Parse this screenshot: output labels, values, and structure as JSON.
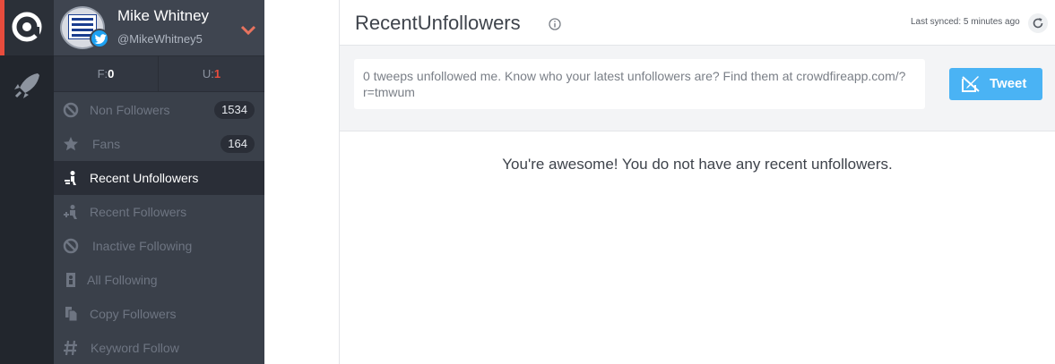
{
  "profile": {
    "name": "Mike Whitney",
    "handle": "@MikeWhitney5"
  },
  "counts": {
    "followers_label": "F:",
    "followers_value": "0",
    "unfollowers_label": "U:",
    "unfollowers_value": "1"
  },
  "nav": [
    {
      "label": "Non Followers",
      "badge": "1534",
      "icon": "ban-icon"
    },
    {
      "label": "Fans",
      "badge": "164",
      "icon": "star-icon"
    },
    {
      "label": "Recent Unfollowers",
      "icon": "user-leave-icon"
    },
    {
      "label": "Recent Followers",
      "icon": "user-add-icon"
    },
    {
      "label": "Inactive Following",
      "icon": "block-icon"
    },
    {
      "label": "All Following",
      "icon": "person-card-icon"
    },
    {
      "label": "Copy Followers",
      "icon": "copy-icon"
    },
    {
      "label": "Keyword Follow",
      "icon": "hashtag-icon"
    }
  ],
  "main": {
    "title": "RecentUnfollowers",
    "sync_text": "Last synced: 5 minutes ago",
    "share_text": "0 tweeps unfollowed me. Know who your latest unfollowers are? Find them at crowdfireapp.com/?r=tmwum",
    "tweet_label": "Tweet",
    "empty_message": "You're awesome! You do not have any recent unfollowers."
  },
  "colors": {
    "accent": "#e84c3d",
    "tweet": "#4ab3f4",
    "sidebar": "#3a404a"
  }
}
